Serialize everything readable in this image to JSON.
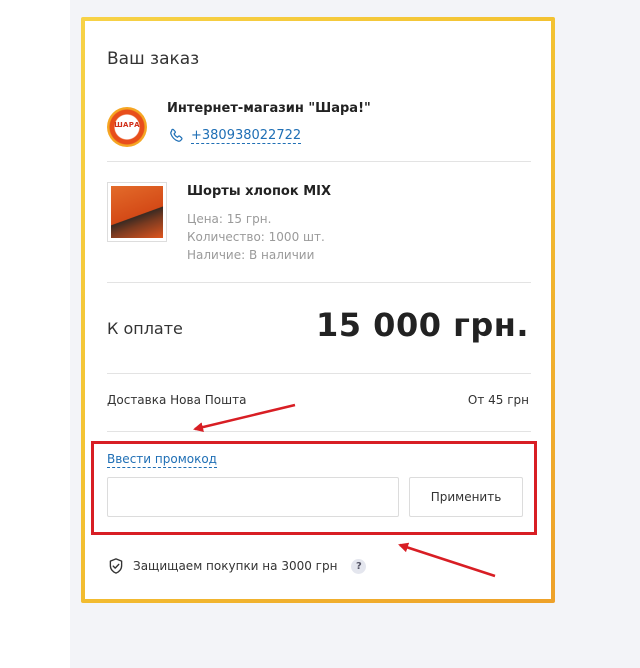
{
  "order": {
    "title": "Ваш заказ",
    "seller": {
      "logo_text": "ШАРА",
      "name": "Интернет-магазин \"Шара!\"",
      "phone": "+380938022722"
    },
    "product": {
      "name": "Шорты хлопок MIX",
      "price": "Цена: 15 грн.",
      "quantity": "Количество: 1000 шт.",
      "availability": "Наличие: В наличии"
    },
    "payment": {
      "label": "К оплате",
      "total": "15 000 грн."
    },
    "delivery": {
      "label": "Доставка Нова Пошта",
      "price": "От 45 грн"
    },
    "promo": {
      "link_label": "Ввести промокод",
      "input_value": "",
      "input_placeholder": "",
      "apply_label": "Применить"
    },
    "protection": {
      "text": "Защищаем покупки на 3000 грн",
      "help": "?"
    }
  },
  "colors": {
    "frame_gradient_start": "#f7d247",
    "frame_gradient_end": "#eea12a",
    "link": "#1f6fb5",
    "annotation_red": "#d81e24",
    "muted_text": "#9a9a9a"
  },
  "icons": {
    "phone": "phone-icon",
    "shield": "shield-icon",
    "help": "help-icon"
  }
}
